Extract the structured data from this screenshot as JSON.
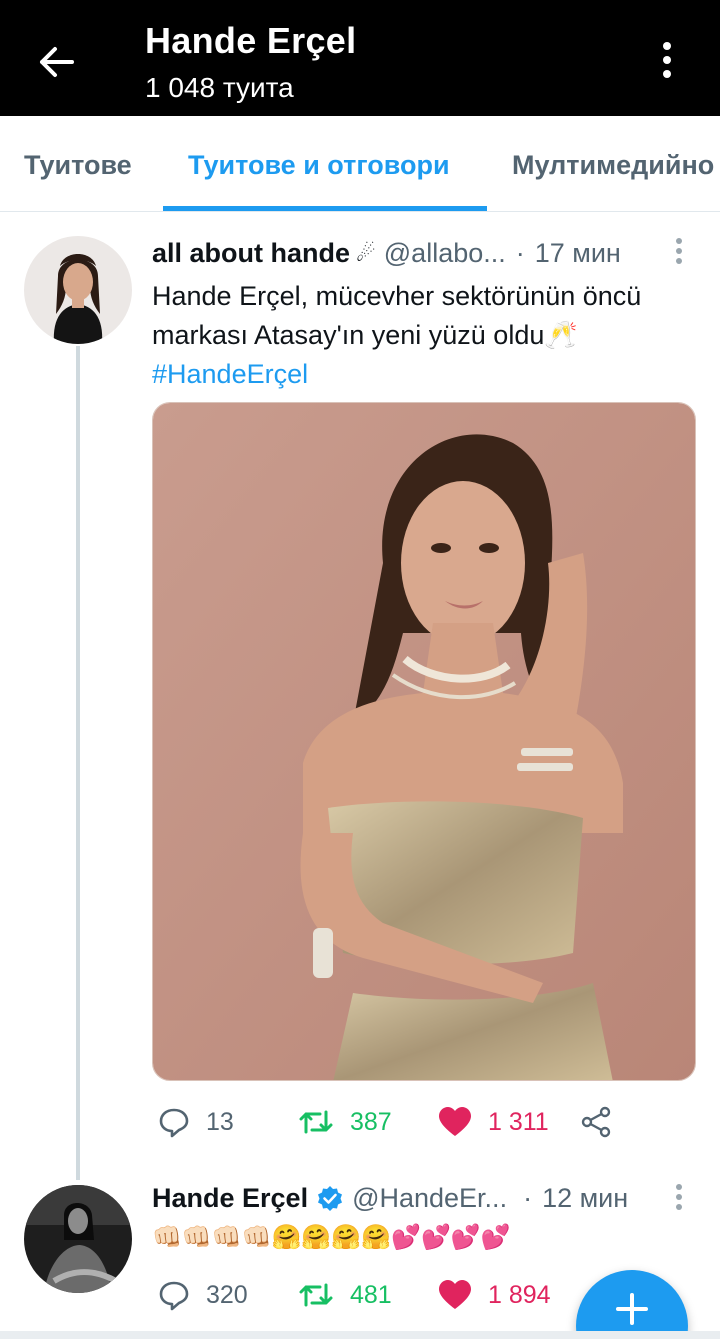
{
  "header": {
    "title": "Hande Erçel",
    "subtitle": "1 048 туита",
    "back_icon": "arrow-left-icon",
    "more_icon": "more-vertical-icon"
  },
  "tabs": [
    {
      "label": "Туитове",
      "active": false
    },
    {
      "label": "Туитове и отговори",
      "active": true
    },
    {
      "label": "Мултимедийно",
      "active": false
    }
  ],
  "tweets": [
    {
      "display_name": "all about hande",
      "name_emoji": "☄",
      "handle": "@allabo...",
      "time": "17 мин",
      "text": "Hande Erçel, mücevher sektörünün öncü markası Atasay'ın yeni yüzü oldu",
      "text_emoji": "🥂",
      "hashtag": "#HandeErçel",
      "has_media": true,
      "replies": "13",
      "retweets": "387",
      "likes": "1 311"
    },
    {
      "display_name": "Hande Erçel",
      "verified": true,
      "handle": "@HandeEr...",
      "time": "12 мин",
      "text": "👊🏻👊🏻👊🏻👊🏻🤗🤗🤗🤗💕💕💕💕",
      "replies": "320",
      "retweets": "481",
      "likes": "1 894"
    }
  ],
  "colors": {
    "accent": "#1d9bf0",
    "retweet": "#17bf63",
    "like": "#e0245e",
    "header_bg": "#000000"
  },
  "fab": {
    "icon": "plus-icon"
  }
}
